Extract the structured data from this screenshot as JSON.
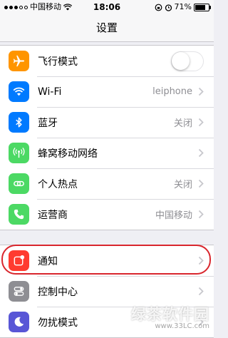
{
  "status_bar": {
    "carrier": "中国移动",
    "time": "18:06",
    "battery": "71%",
    "battery_level": 0.71
  },
  "nav": {
    "title": "设置"
  },
  "group1": [
    {
      "label": "飞行模式",
      "icon": "airplane-icon",
      "color": "#ff9500",
      "toggle": false
    },
    {
      "label": "Wi-Fi",
      "value": "leiphone",
      "icon": "wifi-icon",
      "color": "#007aff"
    },
    {
      "label": "蓝牙",
      "value": "关闭",
      "icon": "bluetooth-icon",
      "color": "#007aff"
    },
    {
      "label": "蜂窝移动网络",
      "icon": "cellular-icon",
      "color": "#4cd964"
    },
    {
      "label": "个人热点",
      "value": "关闭",
      "icon": "hotspot-icon",
      "color": "#4cd964"
    },
    {
      "label": "运营商",
      "value": "中国移动",
      "icon": "phone-icon",
      "color": "#4cd964"
    }
  ],
  "group2": [
    {
      "label": "通知",
      "icon": "notifications-icon",
      "color": "#ff3b30"
    },
    {
      "label": "控制中心",
      "icon": "control-center-icon",
      "color": "#8e8e93"
    },
    {
      "label": "勿扰模式",
      "icon": "moon-icon",
      "color": "#5856d6"
    }
  ],
  "watermark": {
    "text": "绿茶软件园",
    "url": "www.33LC.com"
  }
}
